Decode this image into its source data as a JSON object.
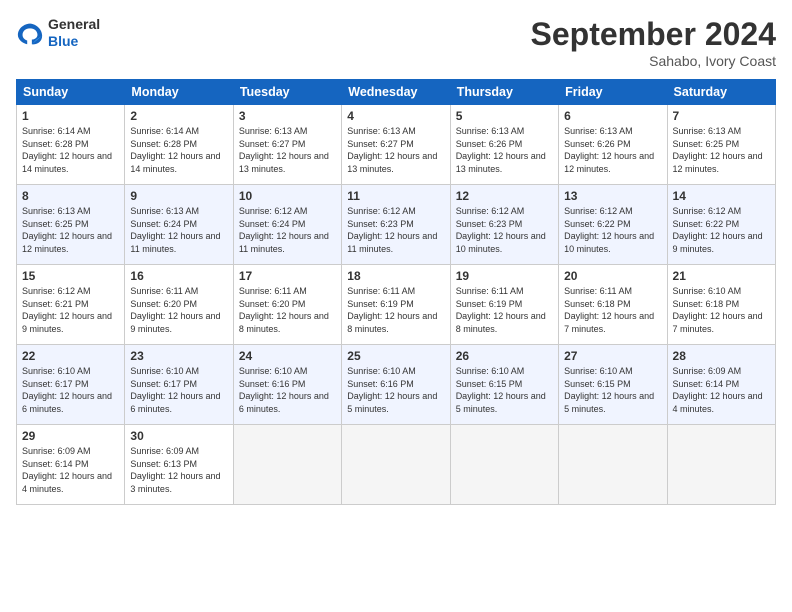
{
  "logo": {
    "general": "General",
    "blue": "Blue"
  },
  "title": "September 2024",
  "subtitle": "Sahabo, Ivory Coast",
  "days_header": [
    "Sunday",
    "Monday",
    "Tuesday",
    "Wednesday",
    "Thursday",
    "Friday",
    "Saturday"
  ],
  "weeks": [
    [
      {
        "day": "1",
        "sunrise": "6:14 AM",
        "sunset": "6:28 PM",
        "daylight": "12 hours and 14 minutes."
      },
      {
        "day": "2",
        "sunrise": "6:14 AM",
        "sunset": "6:28 PM",
        "daylight": "12 hours and 14 minutes."
      },
      {
        "day": "3",
        "sunrise": "6:13 AM",
        "sunset": "6:27 PM",
        "daylight": "12 hours and 13 minutes."
      },
      {
        "day": "4",
        "sunrise": "6:13 AM",
        "sunset": "6:27 PM",
        "daylight": "12 hours and 13 minutes."
      },
      {
        "day": "5",
        "sunrise": "6:13 AM",
        "sunset": "6:26 PM",
        "daylight": "12 hours and 13 minutes."
      },
      {
        "day": "6",
        "sunrise": "6:13 AM",
        "sunset": "6:26 PM",
        "daylight": "12 hours and 12 minutes."
      },
      {
        "day": "7",
        "sunrise": "6:13 AM",
        "sunset": "6:25 PM",
        "daylight": "12 hours and 12 minutes."
      }
    ],
    [
      {
        "day": "8",
        "sunrise": "6:13 AM",
        "sunset": "6:25 PM",
        "daylight": "12 hours and 12 minutes."
      },
      {
        "day": "9",
        "sunrise": "6:13 AM",
        "sunset": "6:24 PM",
        "daylight": "12 hours and 11 minutes."
      },
      {
        "day": "10",
        "sunrise": "6:12 AM",
        "sunset": "6:24 PM",
        "daylight": "12 hours and 11 minutes."
      },
      {
        "day": "11",
        "sunrise": "6:12 AM",
        "sunset": "6:23 PM",
        "daylight": "12 hours and 11 minutes."
      },
      {
        "day": "12",
        "sunrise": "6:12 AM",
        "sunset": "6:23 PM",
        "daylight": "12 hours and 10 minutes."
      },
      {
        "day": "13",
        "sunrise": "6:12 AM",
        "sunset": "6:22 PM",
        "daylight": "12 hours and 10 minutes."
      },
      {
        "day": "14",
        "sunrise": "6:12 AM",
        "sunset": "6:22 PM",
        "daylight": "12 hours and 9 minutes."
      }
    ],
    [
      {
        "day": "15",
        "sunrise": "6:12 AM",
        "sunset": "6:21 PM",
        "daylight": "12 hours and 9 minutes."
      },
      {
        "day": "16",
        "sunrise": "6:11 AM",
        "sunset": "6:20 PM",
        "daylight": "12 hours and 9 minutes."
      },
      {
        "day": "17",
        "sunrise": "6:11 AM",
        "sunset": "6:20 PM",
        "daylight": "12 hours and 8 minutes."
      },
      {
        "day": "18",
        "sunrise": "6:11 AM",
        "sunset": "6:19 PM",
        "daylight": "12 hours and 8 minutes."
      },
      {
        "day": "19",
        "sunrise": "6:11 AM",
        "sunset": "6:19 PM",
        "daylight": "12 hours and 8 minutes."
      },
      {
        "day": "20",
        "sunrise": "6:11 AM",
        "sunset": "6:18 PM",
        "daylight": "12 hours and 7 minutes."
      },
      {
        "day": "21",
        "sunrise": "6:10 AM",
        "sunset": "6:18 PM",
        "daylight": "12 hours and 7 minutes."
      }
    ],
    [
      {
        "day": "22",
        "sunrise": "6:10 AM",
        "sunset": "6:17 PM",
        "daylight": "12 hours and 6 minutes."
      },
      {
        "day": "23",
        "sunrise": "6:10 AM",
        "sunset": "6:17 PM",
        "daylight": "12 hours and 6 minutes."
      },
      {
        "day": "24",
        "sunrise": "6:10 AM",
        "sunset": "6:16 PM",
        "daylight": "12 hours and 6 minutes."
      },
      {
        "day": "25",
        "sunrise": "6:10 AM",
        "sunset": "6:16 PM",
        "daylight": "12 hours and 5 minutes."
      },
      {
        "day": "26",
        "sunrise": "6:10 AM",
        "sunset": "6:15 PM",
        "daylight": "12 hours and 5 minutes."
      },
      {
        "day": "27",
        "sunrise": "6:10 AM",
        "sunset": "6:15 PM",
        "daylight": "12 hours and 5 minutes."
      },
      {
        "day": "28",
        "sunrise": "6:09 AM",
        "sunset": "6:14 PM",
        "daylight": "12 hours and 4 minutes."
      }
    ],
    [
      {
        "day": "29",
        "sunrise": "6:09 AM",
        "sunset": "6:14 PM",
        "daylight": "12 hours and 4 minutes."
      },
      {
        "day": "30",
        "sunrise": "6:09 AM",
        "sunset": "6:13 PM",
        "daylight": "12 hours and 3 minutes."
      },
      null,
      null,
      null,
      null,
      null
    ]
  ]
}
